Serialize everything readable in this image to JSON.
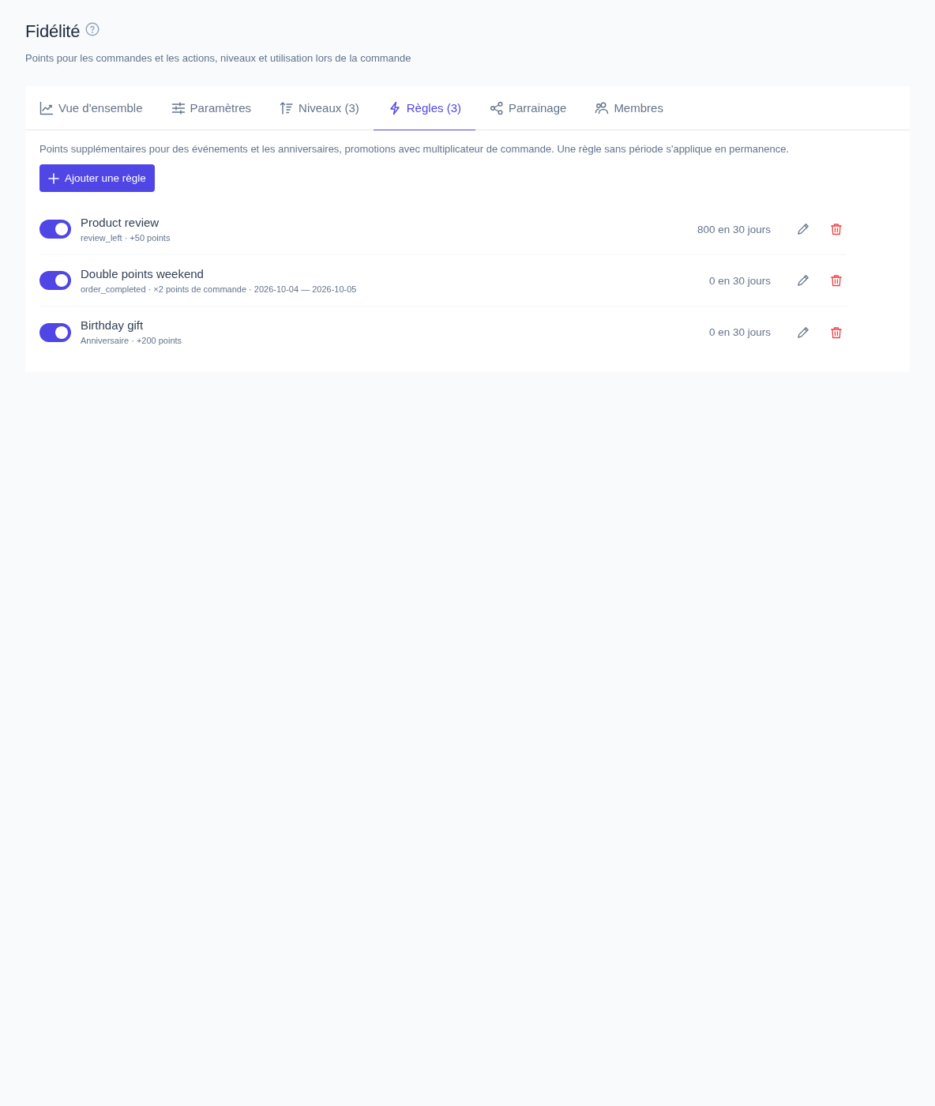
{
  "header": {
    "title": "Fidélité",
    "subtitle": "Points pour les commandes et les actions, niveaux et utilisation lors de la commande"
  },
  "tabs": [
    {
      "label": "Vue d'ensemble",
      "selected": false
    },
    {
      "label": "Paramètres",
      "selected": false
    },
    {
      "label": "Niveaux (3)",
      "selected": false
    },
    {
      "label": "Règles (3)",
      "selected": true
    },
    {
      "label": "Parrainage",
      "selected": false
    },
    {
      "label": "Membres",
      "selected": false
    }
  ],
  "panel": {
    "description": "Points supplémentaires pour des événements et les anniversaires, promotions avec multiplicateur de commande. Une règle sans période s'applique en permanence.",
    "add_button": "Ajouter une règle"
  },
  "rules": [
    {
      "name": "Product review",
      "details": "review_left · +50 points",
      "on": true,
      "usage": "800 en 30 jours"
    },
    {
      "name": "Double points weekend",
      "details": "order_completed · ×2 points de commande · 2026-10-04 — 2026-10-05",
      "on": true,
      "usage": "0 en 30 jours"
    },
    {
      "name": "Birthday gift",
      "details": "Anniversaire · +200 points",
      "on": true,
      "usage": "0 en 30 jours"
    }
  ]
}
